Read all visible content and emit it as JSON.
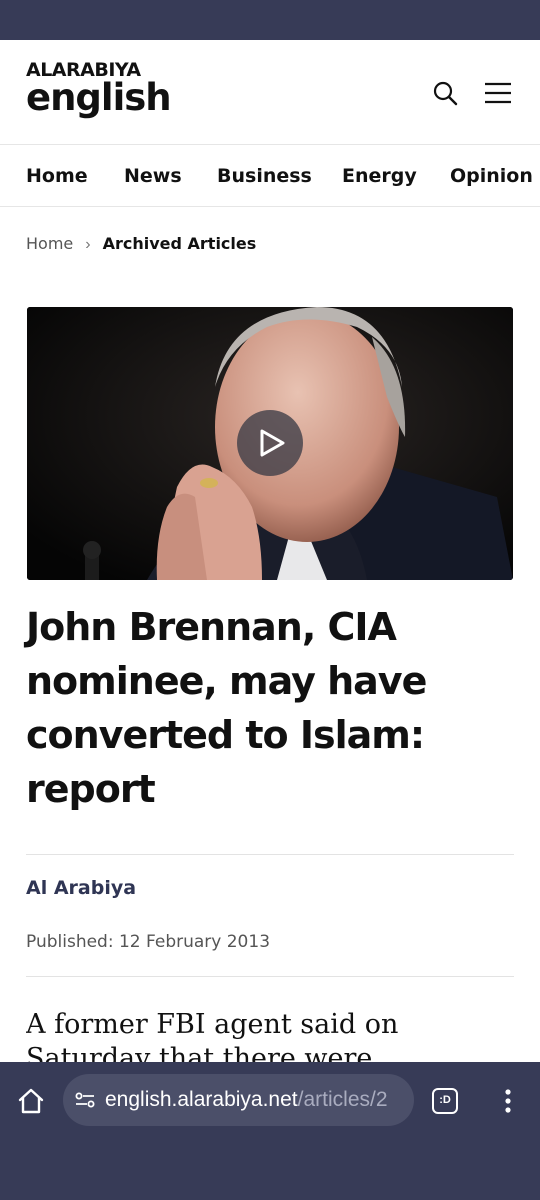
{
  "header": {
    "logo_top": "ALARABIYA",
    "logo_bottom": "english",
    "search_icon": "search-icon",
    "menu_icon": "hamburger-menu-icon"
  },
  "nav": {
    "items": [
      "Home",
      "News",
      "Business",
      "Energy",
      "Opinion"
    ]
  },
  "breadcrumb": {
    "home": "Home",
    "separator": "›",
    "current": "Archived Articles"
  },
  "article": {
    "hero_icon": "play-icon",
    "headline_lines": [
      "John Brennan, CIA",
      "nominee, may have",
      "converted to Islam:",
      "report"
    ],
    "author": "Al Arabiya",
    "published": "Published: 12 February 2013",
    "body_lines": [
      "A former FBI agent said on",
      "Saturday that there were"
    ]
  },
  "browser": {
    "home_icon": "home-icon",
    "url_icon": "site-settings-icon",
    "url_domain": "english.alarabiya.net",
    "url_path": "/articles/2",
    "tab_label": ":D",
    "more_icon": "more-vert-icon"
  },
  "colors": {
    "status_bar": "#373b57",
    "browser_bar": "#373b57",
    "url_pill": "#4b4f69",
    "author": "#2f3554"
  }
}
